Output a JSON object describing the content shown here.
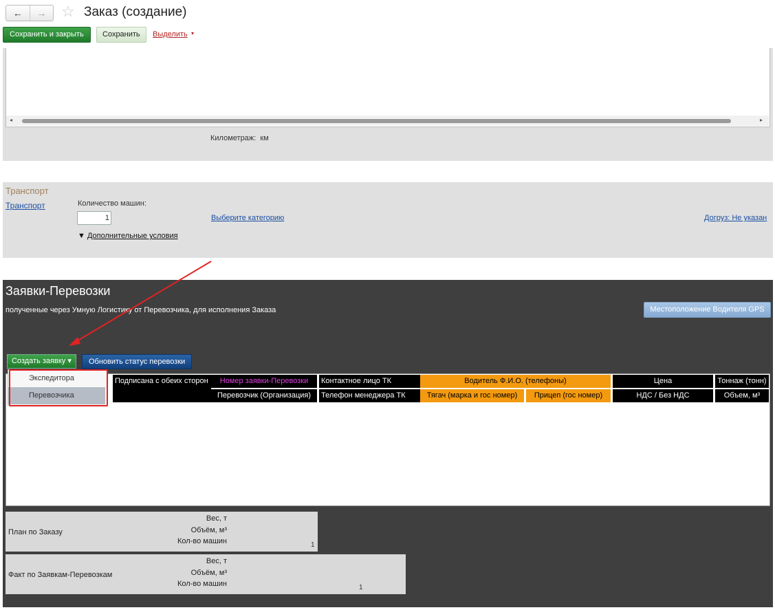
{
  "window": {
    "title": "Заказ (создание)",
    "back_icon": "←",
    "forward_icon": "→",
    "star_icon": "☆"
  },
  "toolbar": {
    "save_close_label": "Сохранить и закрыть",
    "save_label": "Сохранить",
    "select_label": "Выделить",
    "select_caret": "▾"
  },
  "route": {
    "scroll_left": "◂",
    "scroll_right": "▸",
    "mileage_label": "Километраж:",
    "mileage_unit": "км"
  },
  "transport": {
    "header": "Транспорт",
    "link": "Транспорт",
    "cars_label": "Количество машин:",
    "cars_value": "1",
    "category_link": "Выберите категорию",
    "dogruz_link": "Догруз: Не указан",
    "conditions_toggle": "▼",
    "conditions_label": "Дополнительные условия"
  },
  "requests": {
    "title": "Заявки-Перевозки",
    "subtitle": "полученные через Умную Логистику от Перевозчика, для исполнения Заказа",
    "gps_button": "Местоположение Водителя GPS",
    "create_button": "Создать заявку",
    "create_caret": "▾",
    "update_button": "Обновить статус перевозки",
    "dropdown": [
      "Экспедитора",
      "Перевозчика"
    ],
    "columns_row1": [
      "Подписана с обеих сторон",
      "Номер заявки-Перевозки",
      "Контактное лицо ТК",
      "Водитель Ф.И.О. (телефоны)",
      "Цена",
      "Тоннаж (тонн)"
    ],
    "columns_row2": [
      "Перевозчик (Организация)",
      "Телефон менеджера ТК",
      "Тягач (марка и гос номер)",
      "Прицеп (гос номер)",
      "НДС / Без НДС",
      "Объем, м³"
    ]
  },
  "plan": {
    "label": "План по Заказу",
    "weight_label": "Вес, т",
    "volume_label": "Объём, м³",
    "cars_label": "Кол-во машин",
    "cars_value": "1"
  },
  "fact": {
    "label": "Факт по Заявкам-Перевозкам",
    "weight_label": "Вес, т",
    "volume_label": "Объём, м³",
    "cars_label": "Кол-во машин",
    "cars_value": "1"
  }
}
